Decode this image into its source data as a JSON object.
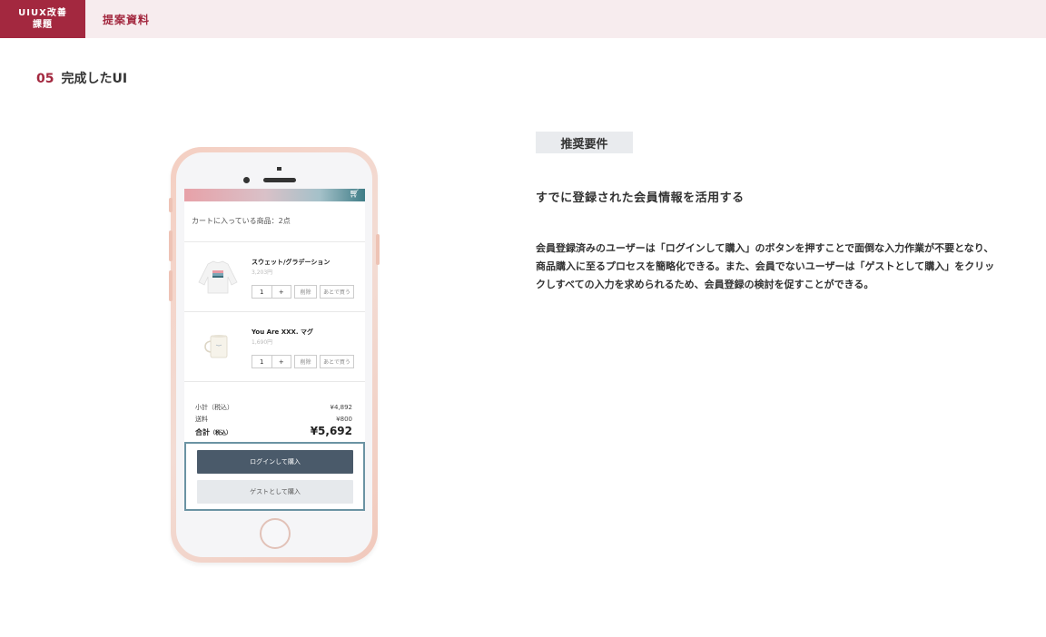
{
  "header": {
    "badge_line1": "UIUX改善",
    "badge_line2": "課題",
    "title": "提案資料"
  },
  "section": {
    "number": "05",
    "title": "完成したUI"
  },
  "phone_screen": {
    "cart_count_text": "カートに入っている商品：2点",
    "items": [
      {
        "name": "スウェット/グラデーション",
        "price": "3,203円",
        "qty": "1",
        "plus": "+",
        "delete": "削除",
        "later": "あとで買う"
      },
      {
        "name": "You Are XXX. マグ",
        "price": "1,690円",
        "qty": "1",
        "plus": "+",
        "delete": "削除",
        "later": "あとで買う"
      }
    ],
    "subtotal_label": "小計（税込）",
    "subtotal_value": "¥4,892",
    "shipping_label": "送料",
    "shipping_value": "¥800",
    "total_label": "合計",
    "total_suffix": "（税込）",
    "total_value": "¥5,692",
    "login_button": "ログインして購入",
    "guest_button": "ゲストとして購入"
  },
  "requirement": {
    "tag": "推奨要件",
    "heading": "すでに登録された会員情報を活用する",
    "description": "会員登録済みのユーザーは「ログインして購入」のボタンを押すことで面倒な入力作業が不要となり、商品購入に至るプロセスを簡略化できる。また、会員でないユーザーは「ゲストとして購入」をクリックしすべての入力を求められるため、会員登録の検討を促すことができる。"
  },
  "colors": {
    "accent": "#a3283f",
    "header_bg": "#f7ecee",
    "login_button": "#4a5a6a",
    "highlight_border": "#6b93a3"
  }
}
